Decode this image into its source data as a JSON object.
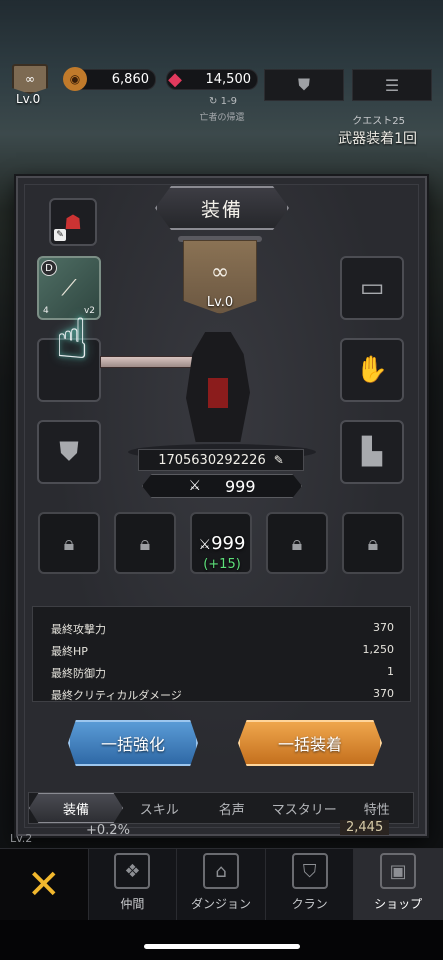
{
  "hud": {
    "level": "Lv.0",
    "gold": "6,860",
    "gems": "14,500",
    "stage": "1-9",
    "stage_name": "亡者の帰還",
    "quest_label": "クエスト25",
    "quest_title": "武器装着1回"
  },
  "panel": {
    "title": "装備",
    "banner_level": "Lv.0",
    "weapon_grade": "D",
    "weapon_level": "4",
    "weapon_tier": "v2",
    "user_id": "1705630292226",
    "power": "999",
    "total_power": "999",
    "power_delta": "(+15)"
  },
  "stats": [
    {
      "label": "最終攻撃力",
      "value": "370"
    },
    {
      "label": "最終HP",
      "value": "1,250"
    },
    {
      "label": "最終防御力",
      "value": "1"
    },
    {
      "label": "最終クリティカルダメージ",
      "value": "370"
    }
  ],
  "actions": {
    "enhance_all": "一括強化",
    "equip_all": "一括装着"
  },
  "tabs": [
    "装備",
    "スキル",
    "名声",
    "マスタリー",
    "特性"
  ],
  "underlay": {
    "bonus": "+0.2%",
    "amount": "2,445",
    "lv": "Lv.2"
  },
  "nav": [
    "仲間",
    "ダンジョン",
    "クラン",
    "ショップ"
  ]
}
